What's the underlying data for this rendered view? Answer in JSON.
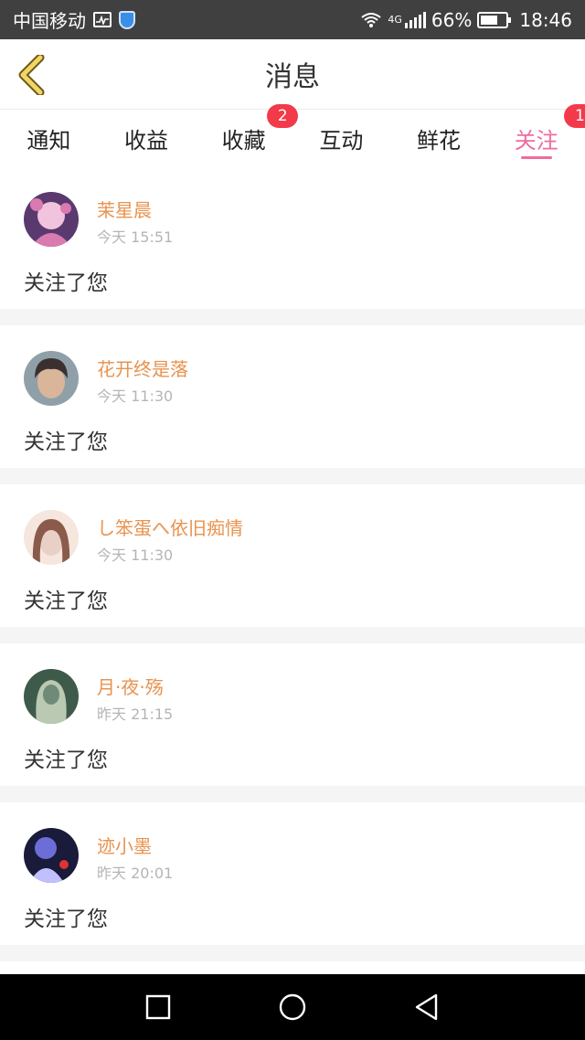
{
  "status_bar": {
    "carrier": "中国移动",
    "network": "4G",
    "battery": "66%",
    "battery_level": 0.66,
    "time": "18:46",
    "icons": [
      "activity-icon",
      "shield-icon",
      "wifi-icon",
      "signal-icon",
      "battery-icon"
    ]
  },
  "header": {
    "title": "消息",
    "back_icon": "chevron-left-icon"
  },
  "tabs": [
    {
      "label": "通知",
      "badge": ""
    },
    {
      "label": "收益",
      "badge": ""
    },
    {
      "label": "收藏",
      "badge": "2"
    },
    {
      "label": "互动",
      "badge": ""
    },
    {
      "label": "鲜花",
      "badge": ""
    },
    {
      "label": "关注",
      "badge": "1",
      "active": true
    }
  ],
  "messages": [
    {
      "name": "茉星晨",
      "time": "今天 15:51",
      "text": "关注了您",
      "avatar_colors": [
        "#d97bb0",
        "#5a3a6e",
        "#f2c3dd"
      ]
    },
    {
      "name": "花开终是落",
      "time": "今天 11:30",
      "text": "关注了您",
      "avatar_colors": [
        "#3a3030",
        "#d9b59a",
        "#8fa0a8"
      ]
    },
    {
      "name": "し笨蛋へ依旧痴情",
      "time": "今天 11:30",
      "text": "关注了您",
      "avatar_colors": [
        "#e9d0c6",
        "#8a5a4a",
        "#f5e6de"
      ]
    },
    {
      "name": "月·夜·殇",
      "time": "昨天 21:15",
      "text": "关注了您",
      "avatar_colors": [
        "#3e5a4a",
        "#b9c9b2",
        "#6f8a78"
      ]
    },
    {
      "name": "迹小墨",
      "time": "昨天 20:01",
      "text": "关注了您",
      "avatar_colors": [
        "#1a1a3a",
        "#6d6dd8",
        "#c0c0ff"
      ]
    }
  ],
  "nav": {
    "icons": [
      "recents-icon",
      "home-icon",
      "back-icon"
    ]
  },
  "colors": {
    "accent": "#f06ba0",
    "name": "#e8934f",
    "badge": "#f33a4a"
  }
}
